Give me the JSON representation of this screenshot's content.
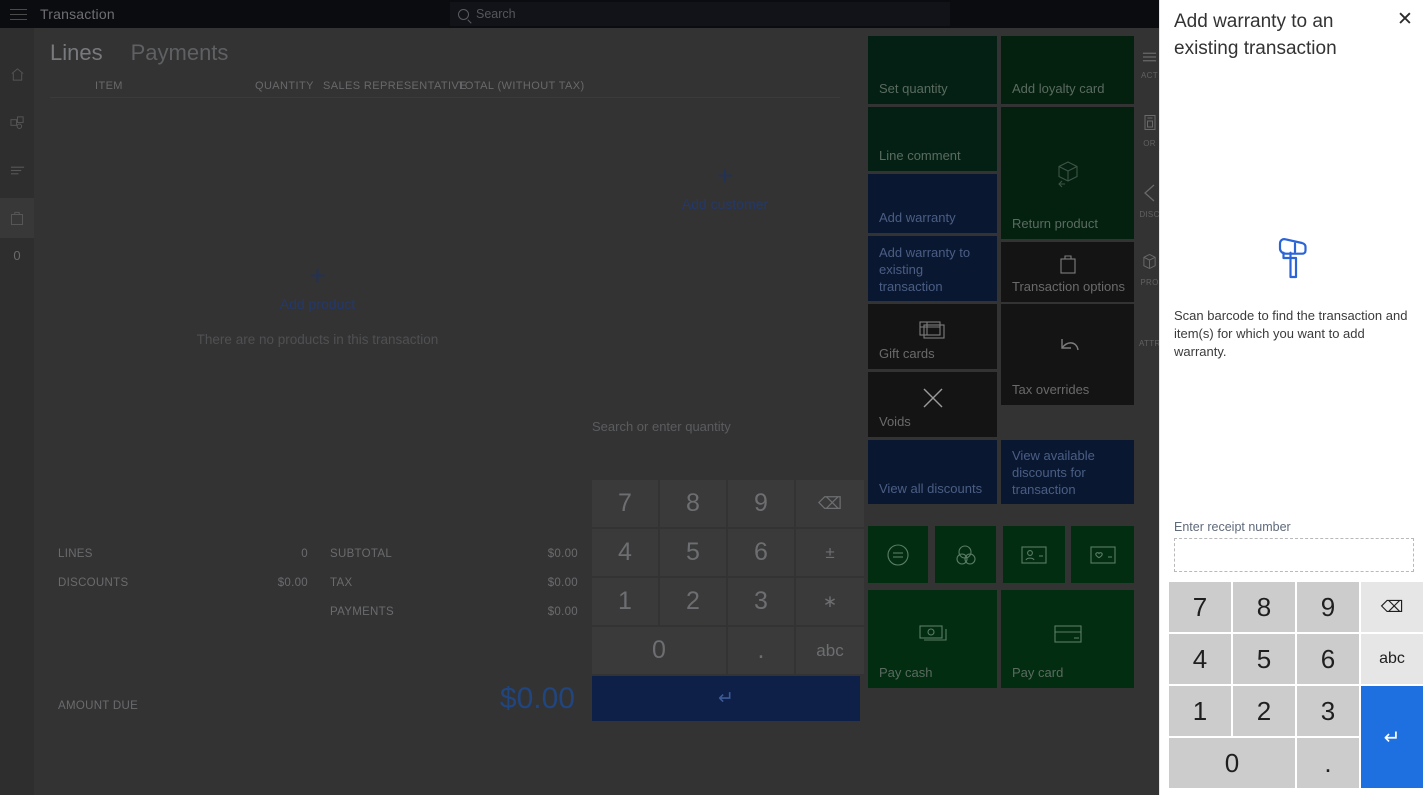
{
  "app": {
    "title": "Transaction",
    "search_placeholder": "Search",
    "left_rail": [
      {
        "name": "home-icon",
        "label": ""
      },
      {
        "name": "products-icon",
        "label": ""
      },
      {
        "name": "list-icon",
        "label": ""
      },
      {
        "name": "cart-icon",
        "label": ""
      }
    ],
    "cart_count": "0",
    "tabs": [
      {
        "label": "Lines",
        "active": true
      },
      {
        "label": "Payments",
        "active": false
      }
    ],
    "grid_headers": [
      "ITEM",
      "QUANTITY",
      "SALES REPRESENTATIVE",
      "TOTAL (WITHOUT TAX)"
    ],
    "empty": {
      "add_product": "Add product",
      "plus": "+",
      "message": "There are no products in this transaction"
    },
    "customer": {
      "plus": "+",
      "add_customer": "Add customer"
    },
    "totals": {
      "lines_label": "LINES",
      "lines_value": "0",
      "discounts_label": "DISCOUNTS",
      "discounts_value": "$0.00",
      "subtotal_label": "SUBTOTAL",
      "subtotal_value": "$0.00",
      "tax_label": "TAX",
      "tax_value": "$0.00",
      "payments_label": "PAYMENTS",
      "payments_value": "$0.00",
      "amount_due_label": "AMOUNT DUE",
      "amount_due_value": "$0.00"
    },
    "numpad": {
      "hint": "Search or enter quantity",
      "keys": [
        "7",
        "8",
        "9",
        "⌫",
        "4",
        "5",
        "6",
        "±",
        "1",
        "2",
        "3",
        "∗",
        "0",
        ".",
        "abc"
      ],
      "enter": "↵"
    },
    "tiles": [
      {
        "label": "Set quantity",
        "style": "g1",
        "icon": ""
      },
      {
        "label": "Add loyalty card",
        "style": "g2",
        "icon": ""
      },
      {
        "label": "Line comment",
        "style": "g1",
        "icon": ""
      },
      {
        "label": "Return product",
        "style": "g2",
        "icon": "return-box-icon"
      },
      {
        "label": "Add warranty",
        "style": "blue",
        "icon": ""
      },
      {
        "label": "Add warranty to existing transaction",
        "style": "blue",
        "icon": ""
      },
      {
        "label": "Transaction options",
        "style": "dark",
        "icon": "bag-icon"
      },
      {
        "label": "Gift cards",
        "style": "dark",
        "icon": "gift-card-icon"
      },
      {
        "label": "Tax overrides",
        "style": "dark",
        "icon": "undo-icon"
      },
      {
        "label": "Voids",
        "style": "dark",
        "icon": "x-icon"
      },
      {
        "label": "View all discounts",
        "style": "blue",
        "icon": ""
      },
      {
        "label": "View available discounts for transaction",
        "style": "blue",
        "icon": ""
      },
      {
        "label": "Pay cash",
        "style": "greenp",
        "icon": "cash-icon"
      },
      {
        "label": "Pay card",
        "style": "greenp",
        "icon": "card-icon"
      }
    ],
    "small_tiles": [
      "equals-icon",
      "coins-icon",
      "id-card-icon",
      "loyalty-card-icon"
    ],
    "right_rail": [
      {
        "icon": "menu-icon",
        "label": "ACT"
      },
      {
        "icon": "order-icon",
        "label": "OR"
      },
      {
        "icon": "discount-tag-icon",
        "label": "DISC"
      },
      {
        "icon": "box-icon",
        "label": "PRO"
      },
      {
        "icon": "",
        "label": "ATTR"
      }
    ]
  },
  "modal": {
    "title": "Add warranty to an existing transaction",
    "close_label": "✕",
    "scan_icon": "barcode-scanner-icon",
    "scan_message": "Scan barcode to find the transaction and item(s) for which you want to add warranty.",
    "field_label": "Enter receipt number",
    "field_value": "",
    "field_placeholder": "",
    "keypad": {
      "keys": [
        "7",
        "8",
        "9",
        "4",
        "5",
        "6",
        "1",
        "2",
        "3",
        "0",
        "."
      ],
      "backspace": "⌫",
      "abc": "abc",
      "enter": "↵"
    },
    "accent_color": "#1e6fe0"
  }
}
